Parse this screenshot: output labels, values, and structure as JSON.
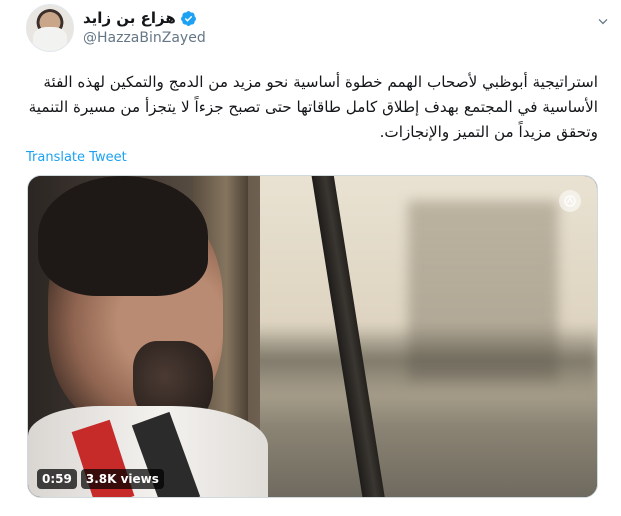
{
  "author": {
    "display_name": "هزاع بن زايد",
    "handle": "@HazzaBinZayed",
    "verified": true
  },
  "tweet": {
    "text_lines": [
      "استراتيجية أبوظبي لأصحاب الهمم خطوة أساسية نحو مزيد من الدمج والتمكين لهذه الفئة",
      "الأساسية في المجتمع بهدف إطلاق كامل طاقاتها حتى تصبح جزءاً لا يتجزأ من مسيرة التنمية",
      "وتحقق مزيداً من التميز والإنجازات."
    ],
    "translate_label": "Translate Tweet"
  },
  "video": {
    "duration": "0:59",
    "views": "3.8K views"
  },
  "icons": {
    "verified": "verified-badge-icon",
    "menu": "chevron-down-icon",
    "watermark": "broadcaster-logo-icon"
  },
  "colors": {
    "accent": "#1da1f2",
    "secondary_text": "#657786",
    "primary_text": "#14171a"
  }
}
